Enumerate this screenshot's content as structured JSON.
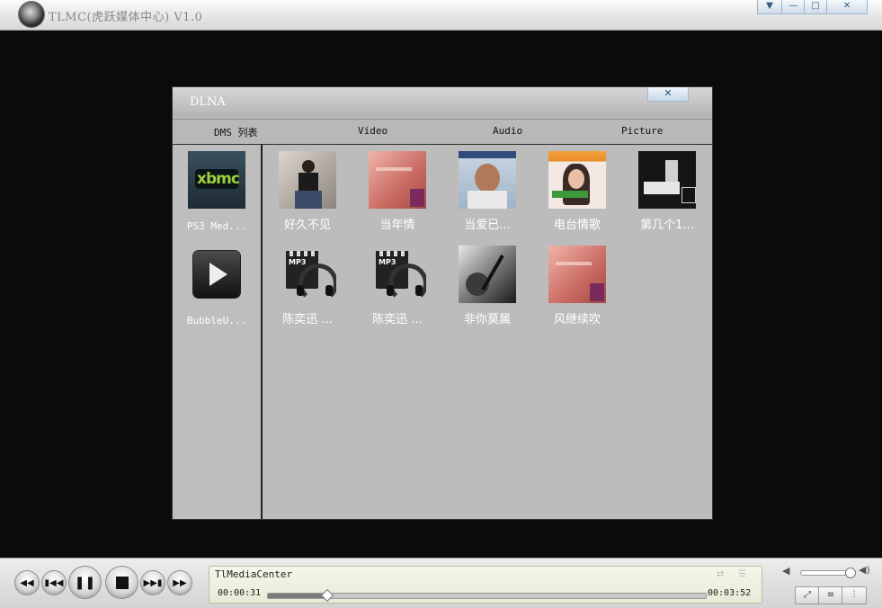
{
  "window": {
    "title": "TLMC(虎跃媒体中心) V1.0",
    "buttons": {
      "dropdown": "▼",
      "minimize": "—",
      "maximize": "□",
      "close": "✕"
    }
  },
  "dlna": {
    "title": "DLNA",
    "close": "✕",
    "tabs": [
      "DMS 列表",
      "Video",
      "Audio",
      "Picture"
    ],
    "servers": [
      {
        "label": "PS3 Med...",
        "icon": "xbmc-logo-icon",
        "logo_text": "xbmc"
      },
      {
        "label": "BubbleU...",
        "icon": "play-button-icon"
      }
    ],
    "items": [
      {
        "label": "好久不见",
        "icon": "album-cover-icon"
      },
      {
        "label": "当年情",
        "icon": "album-cover-icon"
      },
      {
        "label": "当爱已...",
        "icon": "album-cover-icon"
      },
      {
        "label": "电台情歌",
        "icon": "album-cover-icon"
      },
      {
        "label": "第几个1...",
        "icon": "album-cover-icon"
      },
      {
        "label": "陈奕迅 ...",
        "icon": "mp3-file-icon"
      },
      {
        "label": "陈奕迅 ...",
        "icon": "mp3-file-icon"
      },
      {
        "label": "非你莫属",
        "icon": "album-cover-icon"
      },
      {
        "label": "风继续吹",
        "icon": "album-cover-icon"
      }
    ]
  },
  "player": {
    "title": "TlMediaCenter",
    "elapsed": "00:00:31",
    "duration": "00:03:52",
    "progress": 0.134,
    "volume": 0.9,
    "mp3_badge": "MP3",
    "controls": [
      "rewind",
      "previous",
      "pause",
      "stop",
      "next",
      "fast-forward"
    ]
  },
  "colors": {
    "titlebar": "#e6e6e6",
    "dlna_panel": "#bdbdbd",
    "info_panel": "#eef1e0",
    "background": "#0b0b0b"
  }
}
